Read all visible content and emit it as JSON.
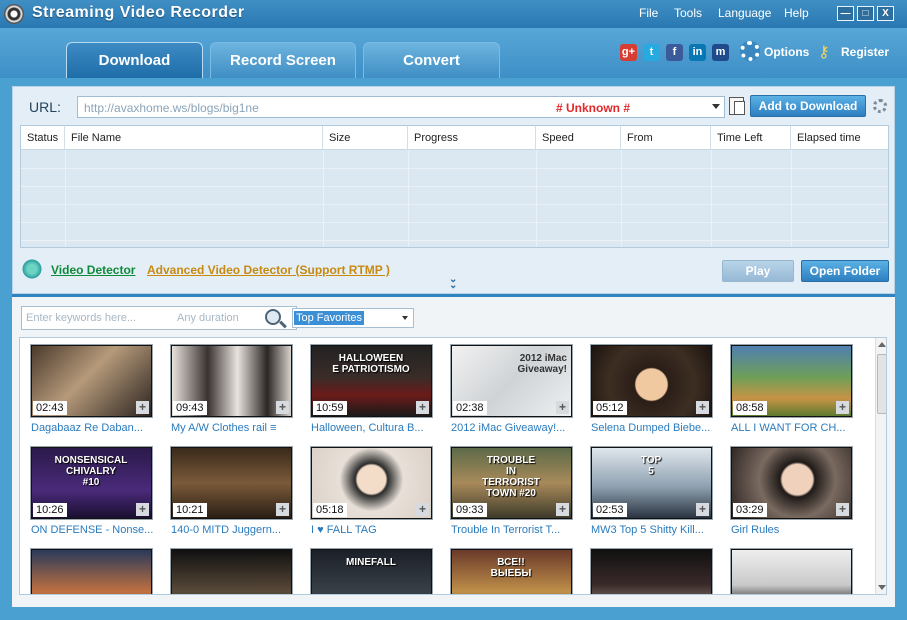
{
  "app": {
    "title": "Streaming Video Recorder"
  },
  "menu": [
    "File",
    "Tools",
    "Language",
    "Help"
  ],
  "window_controls": {
    "minimize": "—",
    "maximize": "□",
    "close": "X"
  },
  "tabs": [
    {
      "label": "Download",
      "active": true
    },
    {
      "label": "Record Screen",
      "active": false
    },
    {
      "label": "Convert",
      "active": false
    }
  ],
  "social": [
    {
      "name": "google-plus-icon",
      "glyph": "g+",
      "color": "#d73d32"
    },
    {
      "name": "twitter-icon",
      "glyph": "t",
      "color": "#28a9e0"
    },
    {
      "name": "facebook-icon",
      "glyph": "f",
      "color": "#3b5a9a"
    },
    {
      "name": "linkedin-icon",
      "glyph": "in",
      "color": "#0a77b5"
    },
    {
      "name": "myspace-icon",
      "glyph": "m",
      "color": "#1f4a8c"
    }
  ],
  "header": {
    "options_label": "Options",
    "register_label": "Register"
  },
  "url_bar": {
    "label": "URL:",
    "value": "http://avaxhome.ws/blogs/big1ne",
    "quality": "# Unknown #",
    "add_button": "Add to Download"
  },
  "download_table": {
    "columns": [
      "Status",
      "File Name",
      "Size",
      "Progress",
      "Speed",
      "From",
      "Time Left",
      "Elapsed time"
    ],
    "rows": []
  },
  "detector": {
    "video_detector": "Video Detector",
    "advanced_detector": "Advanced Video Detector (Support RTMP )",
    "play_button": "Play",
    "open_folder_button": "Open Folder"
  },
  "search": {
    "placeholder": "Enter keywords here...",
    "duration_placeholder": "Any duration",
    "category": "Top Favorites"
  },
  "videos": [
    {
      "duration": "02:43",
      "title": "Dagabaaz Re Daban...",
      "art": "linear-gradient(135deg,#4b3a2c,#b69a7a 45%,#2c2420)"
    },
    {
      "duration": "09:43",
      "title": "My A/W Clothes rail ≡",
      "art": "linear-gradient(90deg,#e8e2dc,#3a3230 30%,#e9e3df 55%,#2b2624 80%,#d8d2cc)"
    },
    {
      "duration": "10:59",
      "title": "Halloween, Cultura B...",
      "art": "linear-gradient(180deg,#222 0,#3a2c28 45%,#6b1b1a 70%,#1a1a1a)",
      "overlay": "HALLOWEEN\nE PATRIOTISMO"
    },
    {
      "duration": "02:38",
      "title": "2012 iMac Giveaway!...",
      "art": "linear-gradient(135deg,#f2f2f2,#cfd3d6 50%,#eef0f1)",
      "overlay": "2012 iMac\nGiveaway!",
      "dark": true
    },
    {
      "duration": "05:12",
      "title": "Selena Dumped Biebe...",
      "art": "radial-gradient(circle at 50% 55%,#f1c9a0 0 22%,#2a1e18 24%,#3d2e22 60%,#1b1410)"
    },
    {
      "duration": "08:58",
      "title": "ALL I WANT FOR CH...",
      "art": "linear-gradient(180deg,#4f7fb0,#6f9f57 45%,#c79346 75%,#5c7a2f)"
    },
    {
      "duration": "10:26",
      "title": "ON DEFENSE - Nonse...",
      "art": "linear-gradient(180deg,#2a1a4a,#4a2a7a 60%,#1a1030)",
      "overlay": "NONSENSICAL\nCHIVALRY\n#10"
    },
    {
      "duration": "10:21",
      "title": "140-0 MITD Juggern...",
      "art": "linear-gradient(180deg,#3a2a1a,#7a5a3a 50%,#2a1e14)"
    },
    {
      "duration": "05:18",
      "title": "I ♥ FALL TAG",
      "art": "radial-gradient(circle at 50% 45%,#f3dcc8 0 20%,#2b2b2b 23%,#e8e0d8 45%,#d9cfc6)"
    },
    {
      "duration": "09:33",
      "title": "Trouble In Terrorist T...",
      "art": "linear-gradient(180deg,#5d6a48,#a88a5a 50%,#3d3a2a)",
      "overlay": "TROUBLE\nIN\nTERRORIST\nTOWN  #20"
    },
    {
      "duration": "02:53",
      "title": "MW3 Top 5 Shitty Kill...",
      "art": "linear-gradient(180deg,#dfe6ec,#8fa1b1 55%,#2a3440)",
      "overlay": "TOP\n5"
    },
    {
      "duration": "03:29",
      "title": "Girl Rules",
      "art": "radial-gradient(circle at 55% 45%,#f0d2bc 0 20%,#1f1a18 23%,#7a6a60 50%,#2a2220)"
    },
    {
      "duration": "",
      "title": "",
      "art": "linear-gradient(180deg,#2a3a5a,#c07040 60%,#1a1a1a)"
    },
    {
      "duration": "",
      "title": "",
      "art": "linear-gradient(180deg,#111,#5a4a3a 60%,#111)"
    },
    {
      "duration": "",
      "title": "",
      "art": "linear-gradient(180deg,#1a1f28,#3a4048 60%,#111)",
      "overlay": "MINEFALL"
    },
    {
      "duration": "",
      "title": "",
      "art": "linear-gradient(180deg,#6a3a2a,#c0904a 60%,#2a1a10)",
      "overlay": "ВСЕ!!\nВЫЕБЫ"
    },
    {
      "duration": "",
      "title": "",
      "art": "linear-gradient(180deg,#111,#3a2a2a 50%,#8a7a70 80%,#111)"
    },
    {
      "duration": "",
      "title": "",
      "art": "linear-gradient(180deg,#eee,#c9c9c9 50%,#222 80%,#e11)"
    }
  ]
}
